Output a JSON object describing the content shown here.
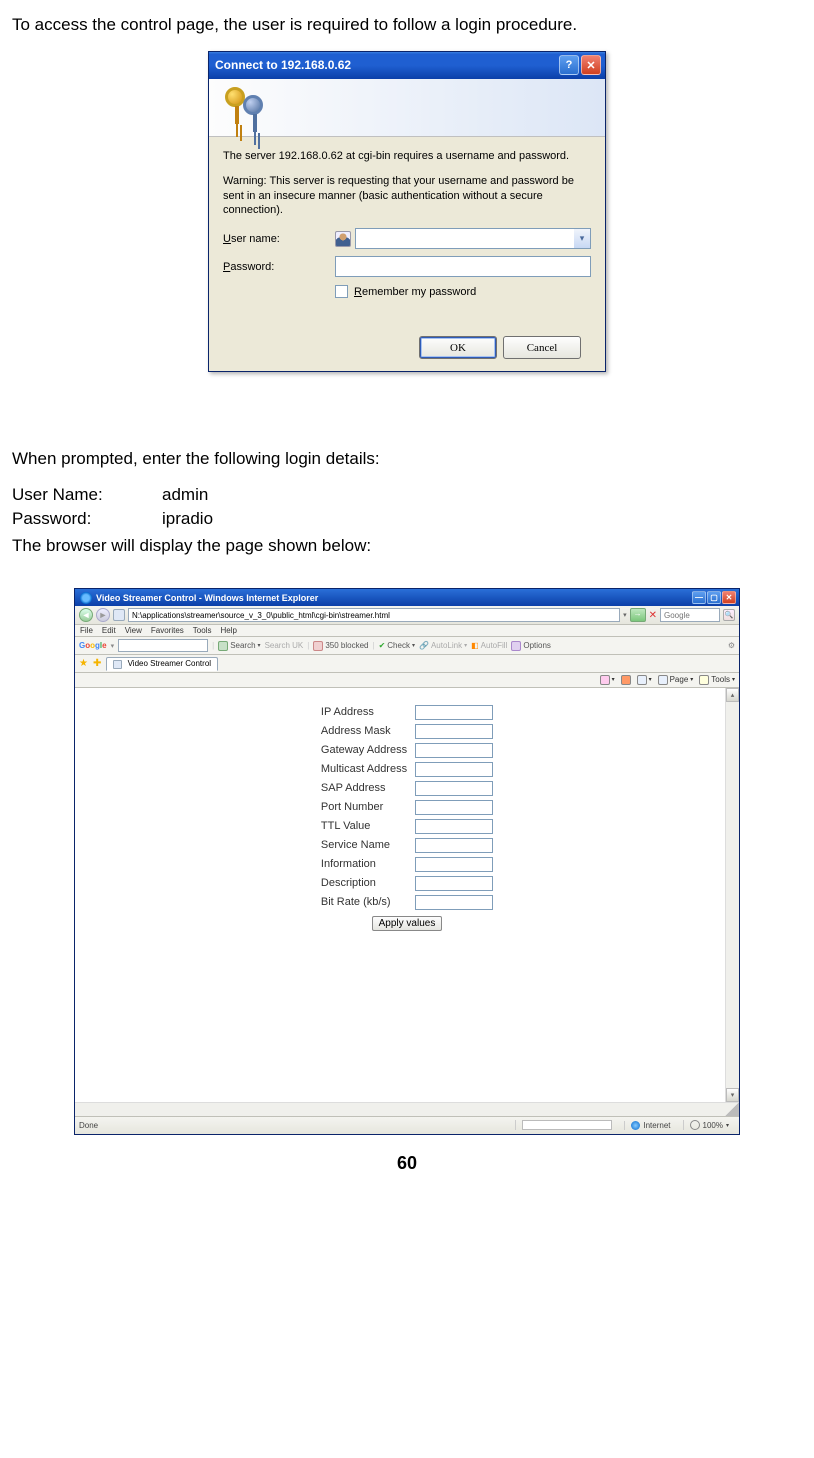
{
  "doc": {
    "intro": "To access the control page, the user is required to follow a login procedure.",
    "prompt_intro": "When prompted, enter the following login details:",
    "username_label": "User Name:",
    "username_value": "admin",
    "password_label": "Password:",
    "password_value": "ipradio",
    "after_login": "The browser will display the page shown below:",
    "page_number": "60"
  },
  "xp_dialog": {
    "title": "Connect to 192.168.0.62",
    "help_btn": "?",
    "close_btn": "✕",
    "msg1": "The server 192.168.0.62 at cgi-bin requires a username and password.",
    "msg2": "Warning: This server is requesting that your username and password be sent in an insecure manner (basic authentication without a secure connection).",
    "user_label_pre": "U",
    "user_label_rest": "ser name:",
    "pass_label_pre": "P",
    "pass_label_rest": "assword:",
    "user_value": "",
    "pass_value": "",
    "remember_pre": "R",
    "remember_rest": "emember my password",
    "ok": "OK",
    "cancel": "Cancel"
  },
  "ie": {
    "title": "Video Streamer Control - Windows Internet Explorer",
    "address": "N:\\applications\\streamer\\source_v_3_0\\public_html\\cgi-bin\\streamer.html",
    "search_placeholder": "Google",
    "menu": {
      "file": "File",
      "edit": "Edit",
      "view": "View",
      "favorites": "Favorites",
      "tools": "Tools",
      "help": "Help"
    },
    "google": {
      "search_btn": "Search",
      "searchuk": "Search UK",
      "blocked": "350 blocked",
      "check": "Check",
      "autolink": "AutoLink",
      "autofill": "AutoFill",
      "options": "Options"
    },
    "tab_name": "Video Streamer Control",
    "cmd": {
      "page": "Page",
      "tools": "Tools"
    },
    "form_labels": {
      "ip": "IP Address",
      "mask": "Address Mask",
      "gateway": "Gateway Address",
      "multicast": "Multicast Address",
      "sap": "SAP Address",
      "port": "Port Number",
      "ttl": "TTL Value",
      "service": "Service Name",
      "info": "Information",
      "desc": "Description",
      "bitrate": "Bit Rate (kb/s)"
    },
    "apply_btn": "Apply values",
    "status": {
      "done": "Done",
      "zone": "Internet",
      "zoom": "100%"
    }
  }
}
